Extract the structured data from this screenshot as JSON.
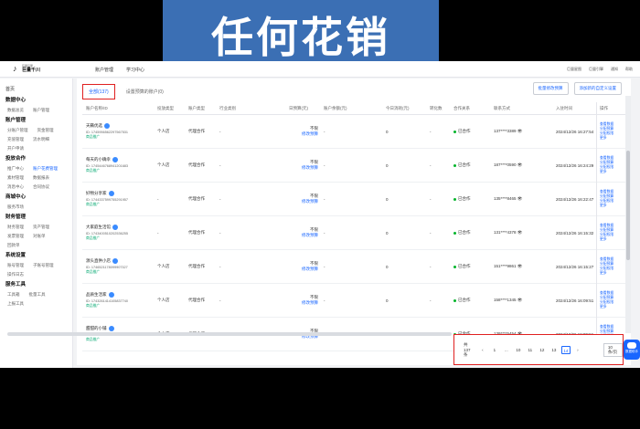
{
  "banner": {
    "title": "任何花销"
  },
  "topbar": {
    "logo_sub": "巨量引擎",
    "logo_main": "巨量千川",
    "nav": [
      "账户管理",
      "学习中心"
    ],
    "right": [
      "巨量星图",
      "巨量引擎",
      "通知",
      "帮助"
    ]
  },
  "sidebar": {
    "items": [
      {
        "kind": "item",
        "label": "首页"
      },
      {
        "kind": "group",
        "label": "数据中心"
      },
      {
        "kind": "row",
        "labels": [
          "数据总览",
          "账户管理"
        ],
        "active": -1
      },
      {
        "kind": "group",
        "label": "账户管理"
      },
      {
        "kind": "row",
        "labels": [
          "分账户管理",
          "资金管理"
        ],
        "active": -1
      },
      {
        "kind": "row",
        "labels": [
          "充值管理",
          "流水明细"
        ],
        "active": -1
      },
      {
        "kind": "row",
        "labels": [
          "开户申请"
        ],
        "active": -1
      },
      {
        "kind": "group",
        "label": "投放合作"
      },
      {
        "kind": "row",
        "labels": [
          "推广中心",
          "账户花费管理"
        ],
        "active": 1
      },
      {
        "kind": "row",
        "labels": [
          "素材管理",
          "数据报表"
        ],
        "active": -1
      },
      {
        "kind": "row",
        "labels": [
          "消息中心",
          "合同协议"
        ],
        "active": -1
      },
      {
        "kind": "group",
        "label": "商城中心"
      },
      {
        "kind": "row",
        "labels": [
          "服务市场"
        ],
        "active": -1
      },
      {
        "kind": "group",
        "label": "财务管理"
      },
      {
        "kind": "row",
        "labels": [
          "财务管理",
          "资产管理"
        ],
        "active": -1
      },
      {
        "kind": "row",
        "labels": [
          "发票管理",
          "对账单"
        ],
        "active": -1
      },
      {
        "kind": "row",
        "labels": [
          "回款单"
        ],
        "active": -1
      },
      {
        "kind": "group",
        "label": "系统设置"
      },
      {
        "kind": "row",
        "labels": [
          "账号管理",
          "子账号管理"
        ],
        "active": -1
      },
      {
        "kind": "row",
        "labels": [
          "操作日志"
        ],
        "active": -1
      },
      {
        "kind": "group",
        "label": "服务工具"
      },
      {
        "kind": "row",
        "labels": [
          "工具箱",
          "批量工具"
        ],
        "active": -1
      },
      {
        "kind": "row",
        "labels": [
          "上报工具"
        ],
        "active": -1
      }
    ]
  },
  "tabs": [
    {
      "label": "全部(137)",
      "active": true
    },
    {
      "label": "设置预算的账户(0)",
      "active": false
    }
  ],
  "toolbar": {
    "buttons": [
      "批量修改预算",
      "添加新的自定义设置"
    ]
  },
  "table": {
    "headers": [
      "账户名称/ID",
      "投放类型",
      "账户类型",
      "行业类别",
      "日预算(元)",
      "账户余额(元)",
      "今日消耗(元)",
      "转化数",
      "合作关系",
      "联系方式",
      "入驻时间"
    ],
    "ops_header": "操作",
    "rows": [
      {
        "name": "天籁优选",
        "id": "ID: 1745956562297567531",
        "tag": "商品推广",
        "type": "个人店",
        "acct": "代理合作",
        "ind": "-",
        "budget": "不限",
        "budget_link": "修改预算",
        "bal": "-",
        "spend": "0",
        "conv": "-",
        "rel": "已合作",
        "phone": "137****3389 👁",
        "time": "2024/12/26 16:27:54"
      },
      {
        "name": "每天的小确幸",
        "id": "ID: 1745446768941201683",
        "tag": "商品推广",
        "type": "个人店",
        "acct": "代理合作",
        "ind": "-",
        "budget": "不限",
        "budget_link": "修改预算",
        "bal": "-",
        "spend": "0",
        "conv": "-",
        "rel": "已合作",
        "phone": "187****0590 👁",
        "time": "2024/12/26 16:24:29"
      },
      {
        "name": "好物分享家",
        "id": "ID: 1744337599755291957",
        "tag": "商品推广",
        "type": "-",
        "acct": "代理合作",
        "ind": "-",
        "budget": "不限",
        "budget_link": "修改预算",
        "bal": "-",
        "spend": "0",
        "conv": "-",
        "rel": "已合作",
        "phone": "135****8465 👁",
        "time": "2024/12/26 16:22:47"
      },
      {
        "name": "大家庭生活馆",
        "id": "ID: 1743400510202536255",
        "tag": "商品推广",
        "type": "-",
        "acct": "代理合作",
        "ind": "-",
        "budget": "不限",
        "budget_link": "修改预算",
        "bal": "-",
        "spend": "0",
        "conv": "-",
        "rel": "已合作",
        "phone": "131****4378 👁",
        "time": "2024/12/26 16:15:32"
      },
      {
        "name": "源头直供小店",
        "id": "ID: 1746521178099907327",
        "tag": "商品推广",
        "type": "个人店",
        "acct": "代理合作",
        "ind": "-",
        "budget": "不限",
        "budget_link": "修改预算",
        "bal": "-",
        "spend": "0",
        "conv": "-",
        "rel": "已合作",
        "phone": "151****9861 👁",
        "time": "2024/12/26 16:15:27"
      },
      {
        "name": "品质生活家",
        "id": "ID: 1743261414105837740",
        "tag": "商品推广",
        "type": "个人店",
        "acct": "代理合作",
        "ind": "-",
        "budget": "不限",
        "budget_link": "修改预算",
        "bal": "-",
        "spend": "0",
        "conv": "-",
        "rel": "已合作",
        "phone": "158****1345 👁",
        "time": "2024/12/26 16:09:51"
      },
      {
        "name": "甜甜的小铺",
        "id": "ID: 1747360298767128408",
        "tag": "商品推广",
        "type": "个人店",
        "acct": "代理合作",
        "ind": "-",
        "budget": "不限",
        "budget_link": "修改预算",
        "bal": "-",
        "spend": "0",
        "conv": "-",
        "rel": "已合作",
        "phone": "139****5454 👁",
        "time": "2024/12/26 16:09:51"
      }
    ],
    "ops": [
      "查看数据",
      "分配预算",
      "分配权限",
      "更多"
    ]
  },
  "pager": {
    "total": "共 137 条",
    "prev": "‹",
    "pages": [
      "1",
      "...",
      "10",
      "11",
      "12",
      "13",
      "14"
    ],
    "active_page": "14",
    "next": "›",
    "size": "10 条/页"
  },
  "helper": {
    "label": "数据助手"
  },
  "colors": {
    "primary": "#1966ff",
    "highlight": "#e02020",
    "banner": "#3b6fb4",
    "success": "#00b42a"
  }
}
